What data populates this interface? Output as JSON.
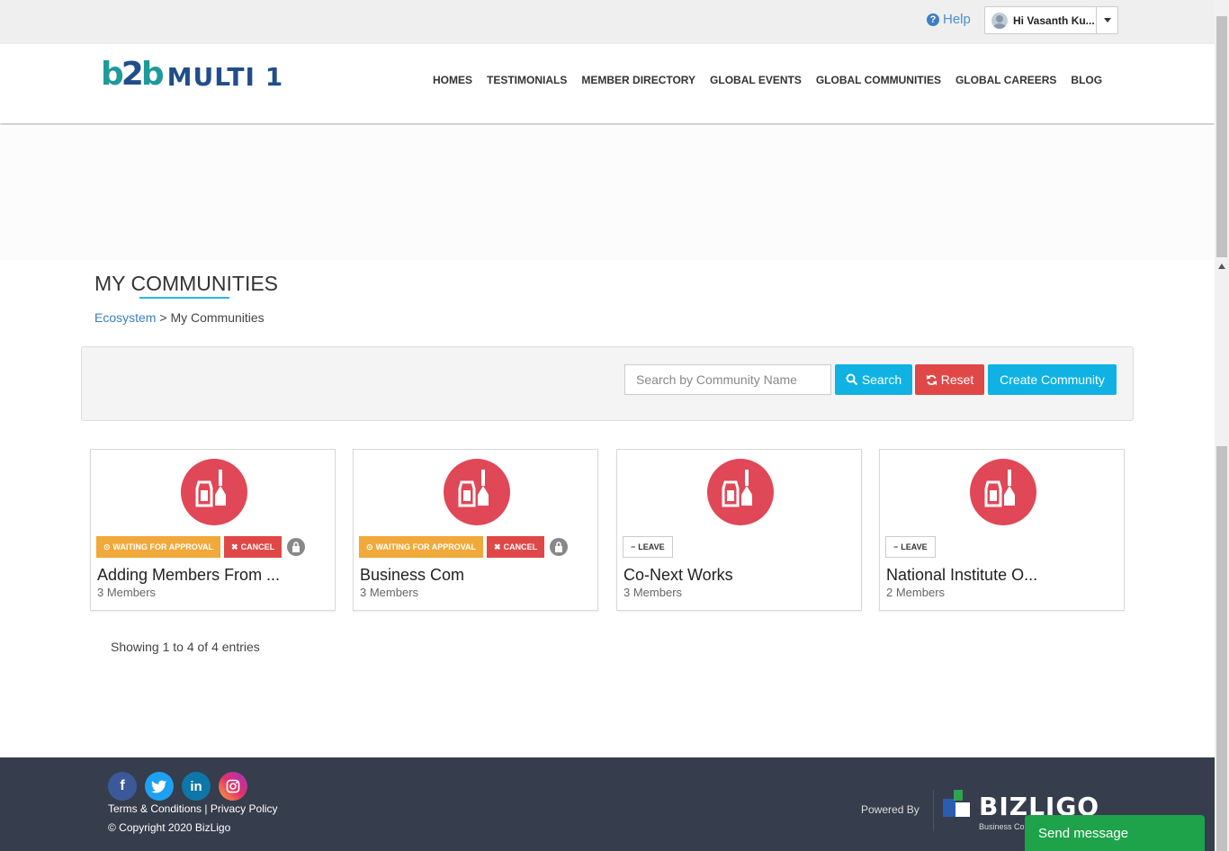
{
  "topbar": {
    "help_label": "Help",
    "user_label": "Hi Vasanth Ku..."
  },
  "brand": {
    "mark_b": "b",
    "mark_2": "2",
    "mark_b2": "b",
    "name": "MULTI 1"
  },
  "nav": {
    "items": [
      "HOMES",
      "TESTIMONIALS",
      "MEMBER DIRECTORY",
      "GLOBAL EVENTS",
      "GLOBAL COMMUNITIES",
      "GLOBAL CAREERS",
      "BLOG"
    ]
  },
  "page": {
    "title": "MY COMMUNITIES",
    "breadcrumb_link": "Ecosystem",
    "breadcrumb_sep": " > ",
    "breadcrumb_current": "My Communities"
  },
  "filter": {
    "search_placeholder": "Search by Community Name",
    "search_button": "Search",
    "reset_button": "Reset",
    "create_button": "Create Community"
  },
  "communities": [
    {
      "name": "Adding Members From ...",
      "members": "3 Members",
      "status": "WAITING FOR APPROVAL",
      "action": "CANCEL"
    },
    {
      "name": "Business Com",
      "members": "3 Members",
      "status": "WAITING FOR APPROVAL",
      "action": "CANCEL"
    },
    {
      "name": "Co-Next Works",
      "members": "3 Members",
      "action": "LEAVE"
    },
    {
      "name": "National Institute O...",
      "members": "2 Members",
      "action": "LEAVE"
    }
  ],
  "pagination": {
    "showing": "Showing 1 to 4 of 4 entries"
  },
  "footer": {
    "terms": "Terms & Conditions",
    "sep": " | ",
    "privacy": "Privacy Policy",
    "copyright": "© Copyright 2020 BizLigo",
    "powered_by": "Powered By",
    "bizligo_name": "BIZLIGO",
    "bizligo_sub": "Business Co",
    "send_message": "Send message"
  },
  "colors": {
    "accent": "#0fb2e3",
    "danger": "#e04848",
    "warning": "#f0a93a",
    "footer_bg": "#363d4c",
    "community_icon_bg": "#e04757",
    "send_message_bg": "#1ea34b"
  },
  "icons": [
    "help-icon",
    "user-avatar-icon",
    "chevron-down-icon",
    "search-icon",
    "refresh-icon",
    "community-icon",
    "clock-icon",
    "close-icon",
    "minus-icon",
    "lock-icon",
    "facebook-icon",
    "twitter-icon",
    "linkedin-icon",
    "instagram-icon",
    "bizligo-logo"
  ]
}
